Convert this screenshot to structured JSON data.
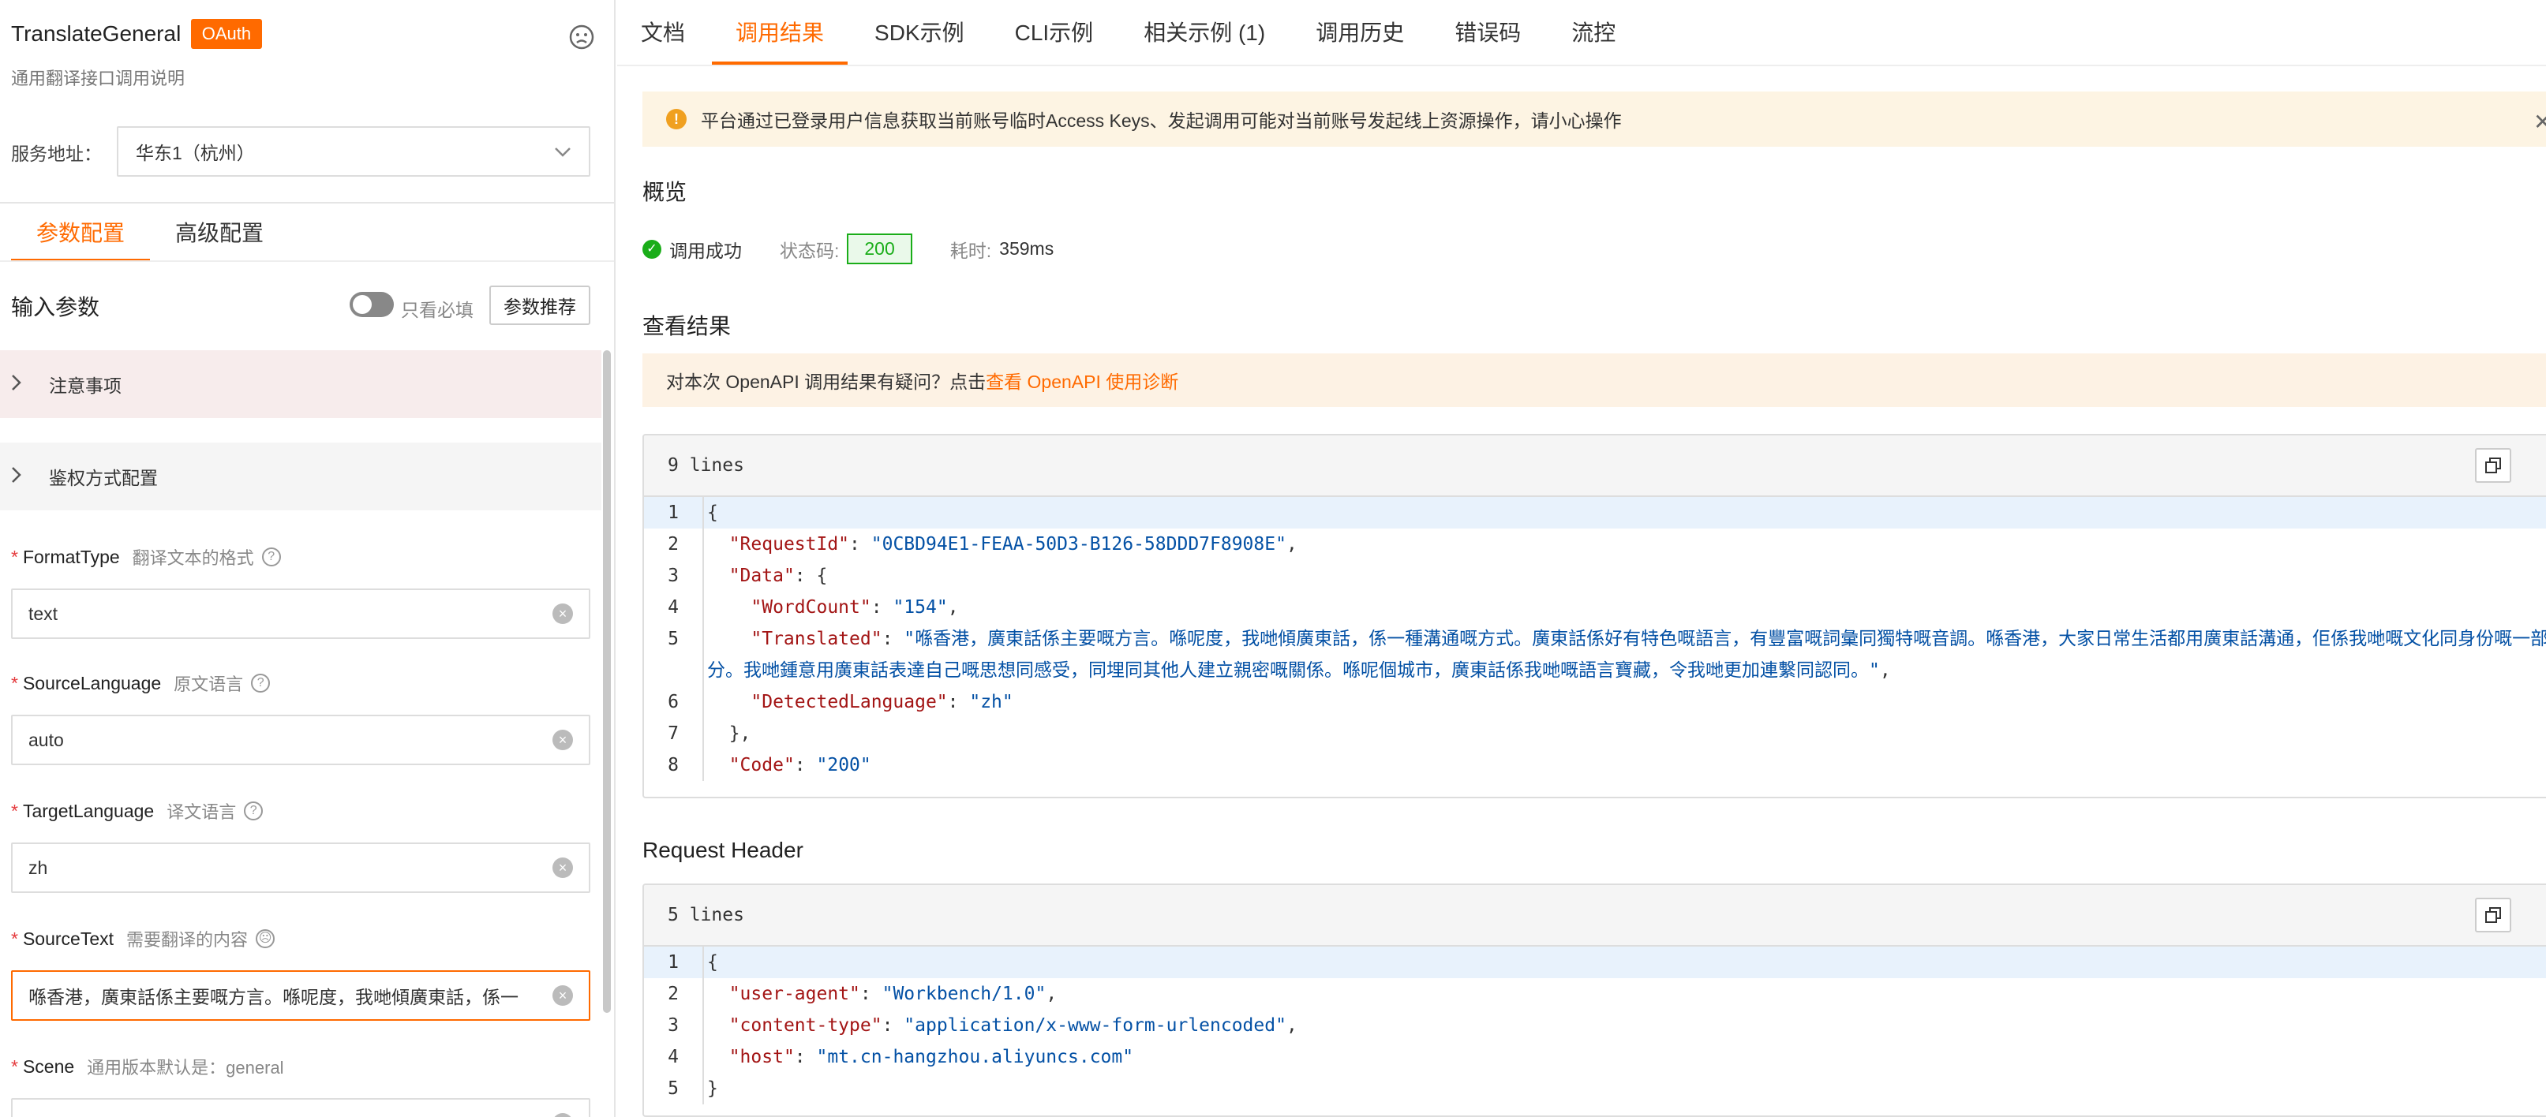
{
  "api": {
    "name": "TranslateGeneral",
    "badge": "OAuth",
    "description": "通用翻译接口调用说明"
  },
  "service": {
    "label": "服务地址：",
    "value": "华东1（杭州）"
  },
  "left_tabs": [
    {
      "label": "参数配置",
      "active": true
    },
    {
      "label": "高级配置",
      "active": false
    }
  ],
  "params_header": {
    "title": "输入参数",
    "toggle_label": "只看必填",
    "recommend_button": "参数推荐"
  },
  "collapsibles": [
    {
      "label": "注意事项"
    },
    {
      "label": "鉴权方式配置"
    }
  ],
  "fields": [
    {
      "name": "FormatType",
      "desc": "翻译文本的格式",
      "value": "text"
    },
    {
      "name": "SourceLanguage",
      "desc": "原文语言",
      "value": "auto"
    },
    {
      "name": "TargetLanguage",
      "desc": "译文语言",
      "value": "zh"
    },
    {
      "name": "SourceText",
      "desc": "需要翻译的内容",
      "value": "喺香港，廣東話係主要嘅方言。喺呢度，我哋傾廣東話，係一"
    },
    {
      "name": "Scene",
      "desc": "通用版本默认是：general",
      "value": ""
    }
  ],
  "right_tabs": [
    {
      "label": "文档",
      "active": false
    },
    {
      "label": "调用结果",
      "active": true
    },
    {
      "label": "SDK示例",
      "active": false
    },
    {
      "label": "CLI示例",
      "active": false
    },
    {
      "label": "相关示例 (1)",
      "active": false
    },
    {
      "label": "调用历史",
      "active": false
    },
    {
      "label": "错误码",
      "active": false
    },
    {
      "label": "流控",
      "active": false
    }
  ],
  "warning": {
    "text": "平台通过已登录用户信息获取当前账号临时Access Keys、发起调用可能对当前账号发起线上资源操作，请小心操作"
  },
  "overview": {
    "title": "概览",
    "status": "调用成功",
    "status_code_label": "状态码:",
    "status_code": "200",
    "time_label": "耗时:",
    "time": "359ms"
  },
  "result": {
    "title": "查看结果",
    "tip_prefix": "对本次 OpenAPI 调用结果有疑问？点击",
    "tip_link": "查看 OpenAPI 使用诊断",
    "lines_label": "9 lines",
    "lines": [
      "{",
      "  \"RequestId\": \"0CBD94E1-FEAA-50D3-B126-58DDD7F8908E\",",
      "  \"Data\": {",
      "    \"WordCount\": \"154\",",
      "    \"Translated\": \"喺香港，廣東話係主要嘅方言。喺呢度，我哋傾廣東話，係一種溝通嘅方式。廣東話係好有特色嘅語言，有豐富嘅詞彙同獨特嘅音調。喺香港，大家日常生活都用廣東話溝通，佢係我哋嘅文化同身份嘅一部分。我哋鍾意用廣東話表達自己嘅思想同感受，同埋同其他人建立親密嘅關係。喺呢個城市，廣東話係我哋嘅語言寶藏，令我哋更加連繫同認同。\",",
      "    \"DetectedLanguage\": \"zh\"",
      "  },",
      "  \"Code\": \"200\""
    ]
  },
  "request_header": {
    "title": "Request Header",
    "lines_label": "5 lines",
    "lines": [
      "{",
      "  \"user-agent\": \"Workbench/1.0\",",
      "  \"content-type\": \"application/x-www-form-urlencoded\",",
      "  \"host\": \"mt.cn-hangzhou.aliyuncs.com\"",
      "}"
    ]
  },
  "colors": {
    "accent": "#ff6a00",
    "success": "#1aad19",
    "warning_bg": "#fdf4e3",
    "json_key": "#a31515",
    "json_string": "#0451a5"
  },
  "icons": [
    "face-icon",
    "chevron-down-icon",
    "chevron-right-icon",
    "question-icon",
    "clear-icon",
    "warning-icon",
    "close-icon",
    "success-icon",
    "copy-icon"
  ]
}
